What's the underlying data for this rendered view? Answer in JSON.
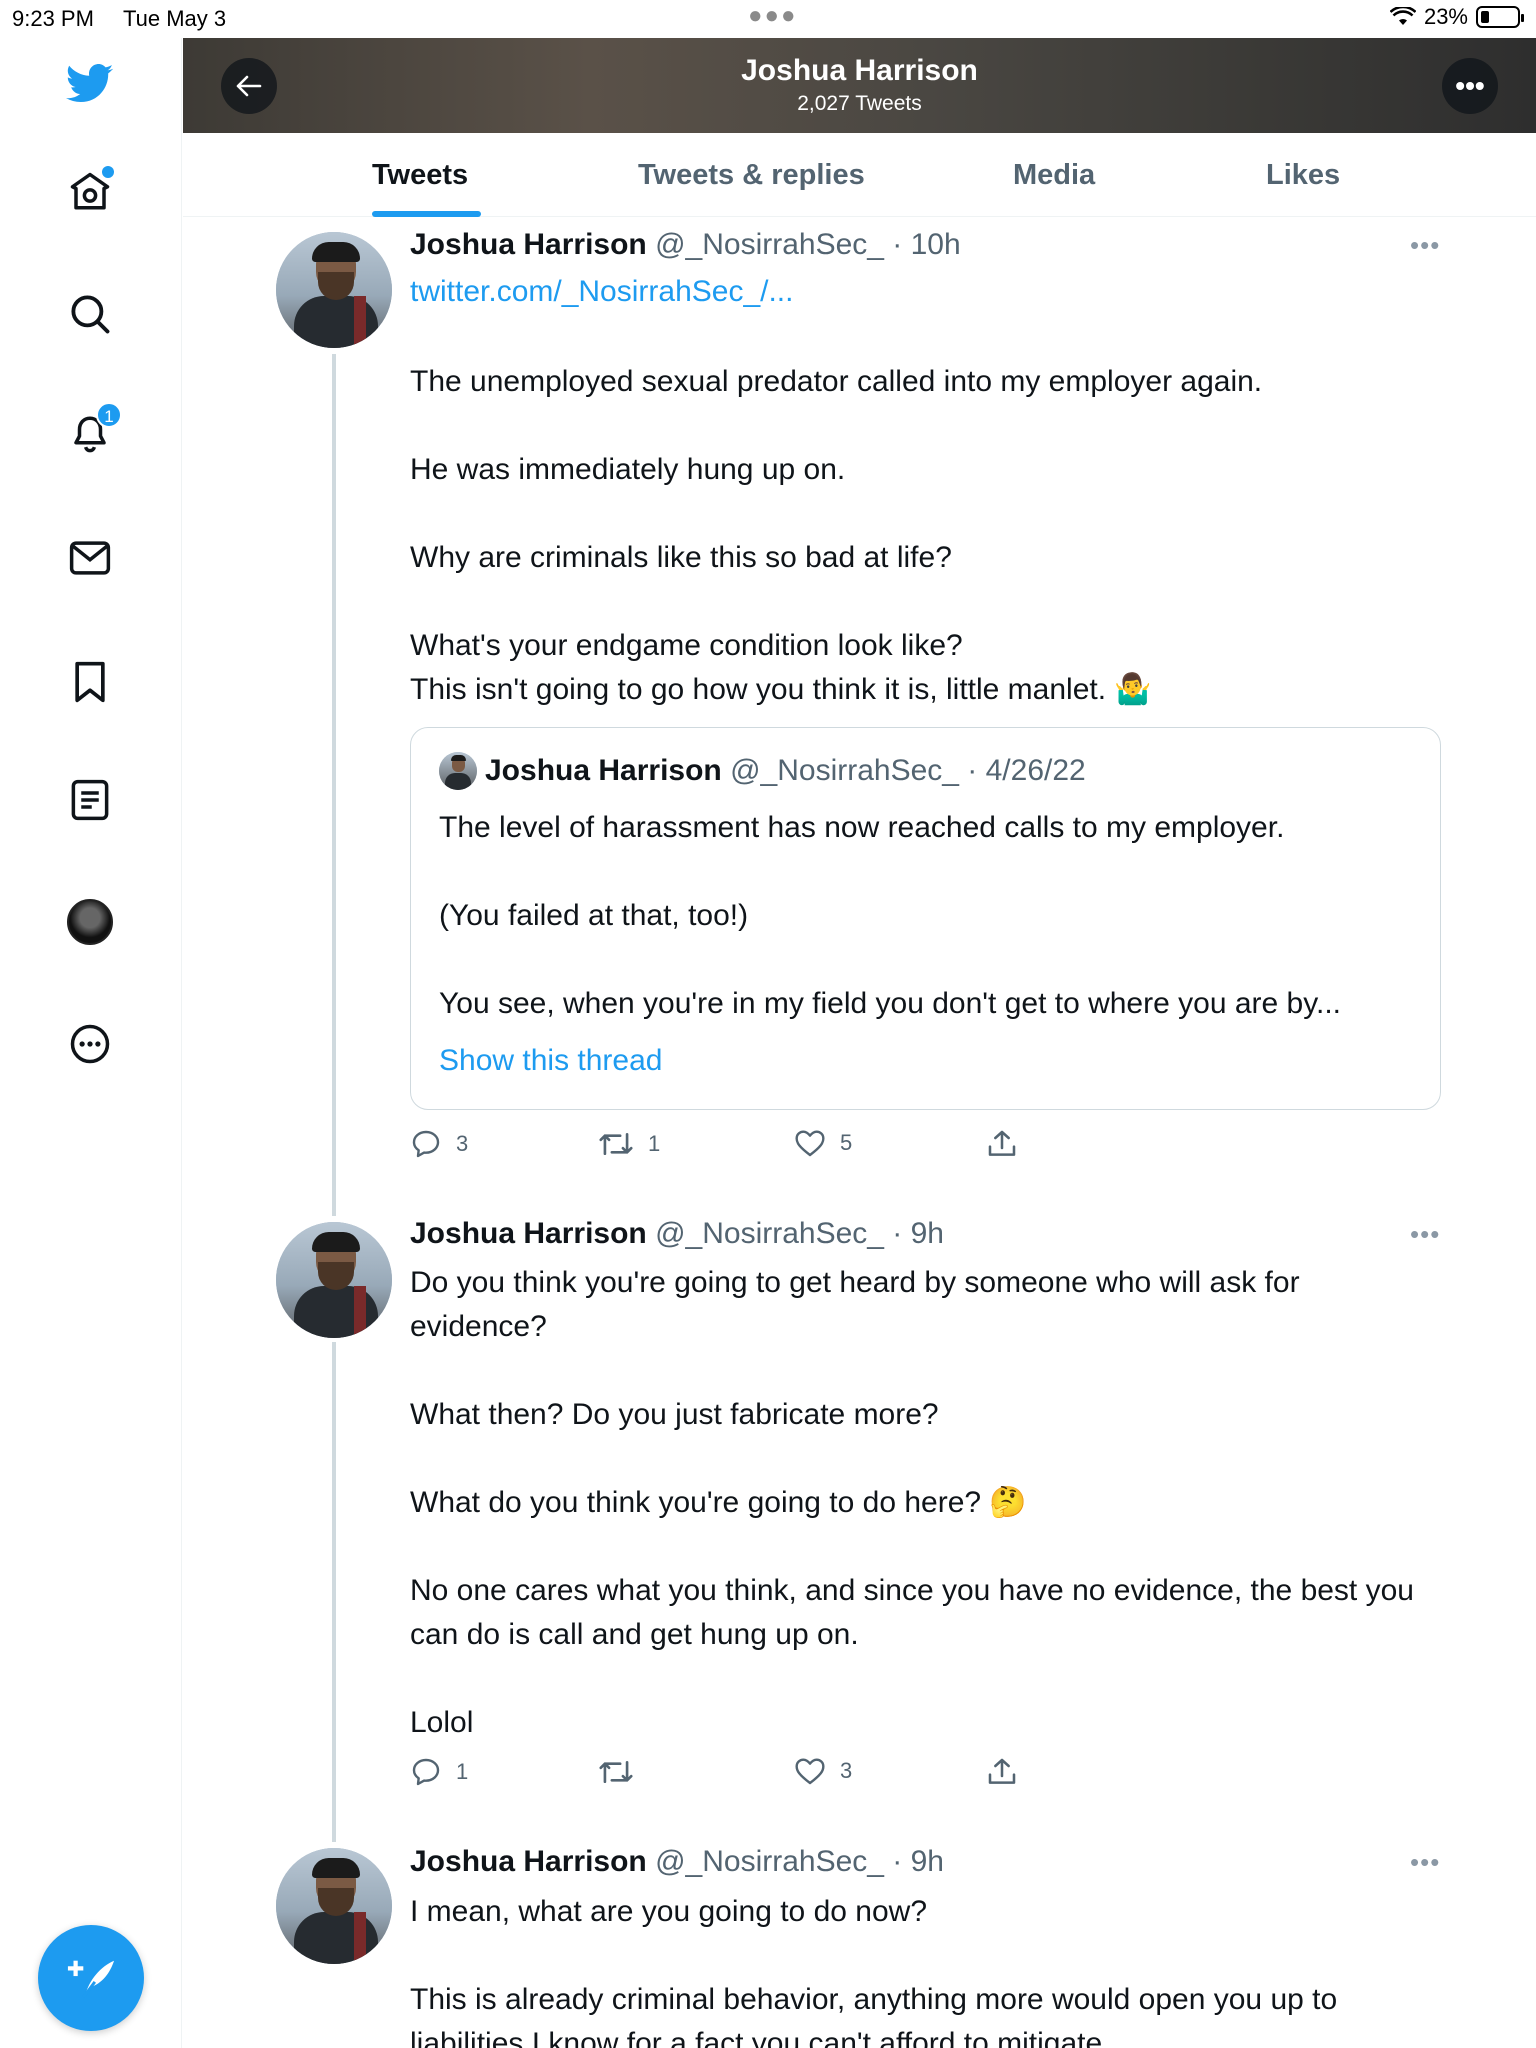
{
  "status_bar": {
    "time": "9:23 PM",
    "date": "Tue May 3",
    "battery": "23%"
  },
  "header": {
    "name": "Joshua Harrison",
    "tweet_count": "2,027 Tweets"
  },
  "tabs": [
    {
      "label": "Tweets",
      "active": true
    },
    {
      "label": "Tweets & replies",
      "active": false
    },
    {
      "label": "Media",
      "active": false
    },
    {
      "label": "Likes",
      "active": false
    }
  ],
  "sidebar": {
    "notifications_badge": "1"
  },
  "tweets": [
    {
      "name": "Joshua Harrison",
      "handle": "@_NosirrahSec_ · 10h",
      "link": "twitter.com/_NosirrahSec_/...",
      "lines": [
        "The unemployed sexual predator called into my employer again.",
        "He was immediately hung up on.",
        "Why are criminals like this so bad at life?",
        "What's your endgame condition look like?",
        "This isn't going to go how you think it is, little manlet. 🤷‍♂️"
      ],
      "quote": {
        "name": "Joshua Harrison",
        "handle": "@_NosirrahSec_ · 4/26/22",
        "lines": [
          "The level of harassment has now reached calls to my employer.",
          "(You failed at that, too!)",
          "You see, when you're in my field you don't get to where you are by..."
        ],
        "show_thread": "Show this thread"
      },
      "replies": "3",
      "retweets": "1",
      "likes": "5"
    },
    {
      "name": "Joshua Harrison",
      "handle": "@_NosirrahSec_ · 9h",
      "lines": [
        "Do you think you're going to get heard by someone who will ask for evidence?",
        "What then? Do you just fabricate more?",
        "What do you think you're going to do here? 🤔",
        "No one cares what you think, and since you have no evidence, the best you can do is call and get hung up on.",
        "Lolol"
      ],
      "replies": "1",
      "retweets": "",
      "likes": "3"
    },
    {
      "name": "Joshua Harrison",
      "handle": "@_NosirrahSec_ · 9h",
      "lines": [
        "I mean, what are you going to do now?",
        "This is already criminal behavior, anything more would open you up to liabilities I know for a fact you can't afford to mitigate."
      ]
    }
  ]
}
